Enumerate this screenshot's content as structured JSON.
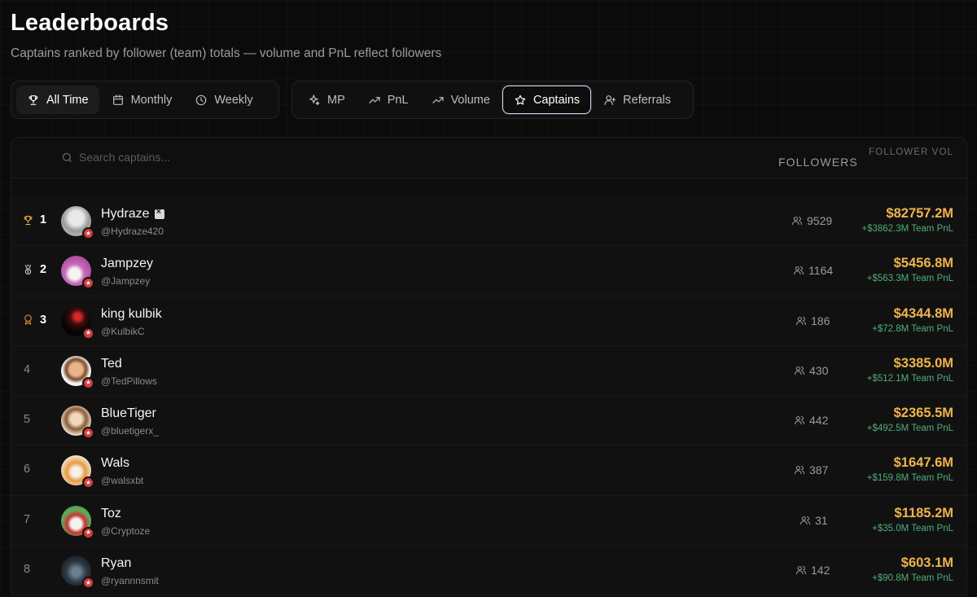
{
  "header": {
    "title": "Leaderboards",
    "subtitle": "Captains ranked by follower (team) totals — volume and PnL reflect followers"
  },
  "time_filters": [
    {
      "label": "All Time",
      "icon": "trophy-icon",
      "active": true
    },
    {
      "label": "Monthly",
      "icon": "calendar-icon",
      "active": false
    },
    {
      "label": "Weekly",
      "icon": "clock-icon",
      "active": false
    }
  ],
  "metric_filters": [
    {
      "label": "MP",
      "icon": "sparkle-icon",
      "active": false
    },
    {
      "label": "PnL",
      "icon": "trend-up-icon",
      "active": false
    },
    {
      "label": "Volume",
      "icon": "trend-up-icon",
      "active": false
    },
    {
      "label": "Captains",
      "icon": "star-icon",
      "active": true
    },
    {
      "label": "Referrals",
      "icon": "user-plus-icon",
      "active": false
    }
  ],
  "table": {
    "search_placeholder": "Search captains...",
    "col_followers": "FOLLOWERS",
    "col_volume": "FOLLOWER VOL",
    "rows": [
      {
        "rank": "1",
        "name": "Hydraze",
        "handle": "@Hydraze420",
        "followers": "9529",
        "volume": "$82757.2M",
        "pnl": "+$3862.3M Team PnL",
        "rank_icon": "trophy-icon",
        "rank_color": "#f0b44c"
      },
      {
        "rank": "2",
        "name": "Jampzey",
        "handle": "@Jampzey",
        "followers": "1164",
        "volume": "$5456.8M",
        "pnl": "+$563.3M Team PnL",
        "rank_icon": "medal-icon",
        "rank_color": "#c9c9c9"
      },
      {
        "rank": "3",
        "name": "king kulbik",
        "handle": "@KulbikC",
        "followers": "186",
        "volume": "$4344.8M",
        "pnl": "+$72.8M Team PnL",
        "rank_icon": "award-icon",
        "rank_color": "#e08a3c"
      },
      {
        "rank": "4",
        "name": "Ted",
        "handle": "@TedPillows",
        "followers": "430",
        "volume": "$3385.0M",
        "pnl": "+$512.1M Team PnL"
      },
      {
        "rank": "5",
        "name": "BlueTiger",
        "handle": "@bluetigerx_",
        "followers": "442",
        "volume": "$2365.5M",
        "pnl": "+$492.5M Team PnL"
      },
      {
        "rank": "6",
        "name": "Wals",
        "handle": "@walsxbt",
        "followers": "387",
        "volume": "$1647.6M",
        "pnl": "+$159.8M Team PnL"
      },
      {
        "rank": "7",
        "name": "Toz",
        "handle": "@Cryptoze",
        "followers": "31",
        "volume": "$1185.2M",
        "pnl": "+$35.0M Team PnL"
      },
      {
        "rank": "8",
        "name": "Ryan",
        "handle": "@ryannnsmit",
        "followers": "142",
        "volume": "$603.1M",
        "pnl": "+$90.8M Team PnL"
      }
    ]
  }
}
